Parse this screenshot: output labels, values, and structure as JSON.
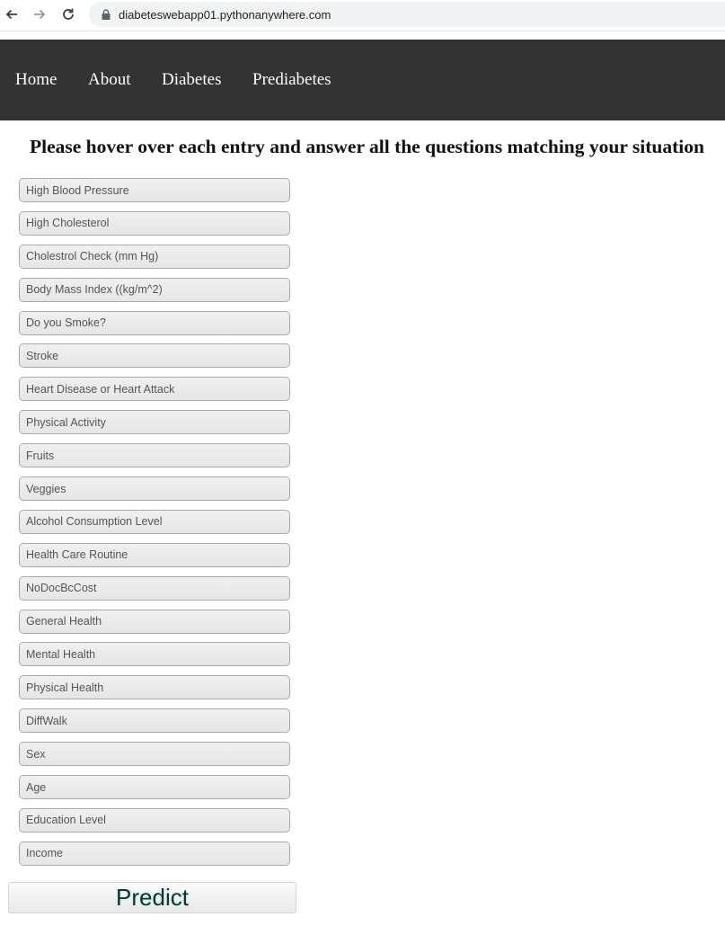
{
  "browser": {
    "url": "diabeteswebapp01.pythonanywhere.com",
    "icons": {
      "back": "arrow-left-icon",
      "forward": "arrow-right-icon",
      "reload": "reload-icon",
      "secure": "lock-icon"
    }
  },
  "nav": {
    "items": [
      {
        "label": "Home"
      },
      {
        "label": "About"
      },
      {
        "label": "Diabetes"
      },
      {
        "label": "Prediabetes"
      }
    ],
    "background": "#333333",
    "text_color": "#ffffff"
  },
  "heading": "Please hover over each entry and answer all the questions matching your situation",
  "form": {
    "fields": [
      {
        "placeholder": "High Blood Pressure"
      },
      {
        "placeholder": "High Cholesterol"
      },
      {
        "placeholder": "Cholestrol Check (mm Hg)"
      },
      {
        "placeholder": "Body Mass Index ((kg/m^2)"
      },
      {
        "placeholder": "Do you Smoke?"
      },
      {
        "placeholder": "Stroke"
      },
      {
        "placeholder": "Heart Disease or Heart Attack"
      },
      {
        "placeholder": "Physical Activity"
      },
      {
        "placeholder": "Fruits"
      },
      {
        "placeholder": "Veggies"
      },
      {
        "placeholder": "Alcohol Consumption Level"
      },
      {
        "placeholder": "Health Care Routine"
      },
      {
        "placeholder": "NoDocBcCost"
      },
      {
        "placeholder": "General Health"
      },
      {
        "placeholder": "Mental Health"
      },
      {
        "placeholder": "Physical Health"
      },
      {
        "placeholder": "DiffWalk"
      },
      {
        "placeholder": "Sex"
      },
      {
        "placeholder": "Age"
      },
      {
        "placeholder": "Education Level"
      },
      {
        "placeholder": "Income"
      }
    ],
    "submit_label": "Predict"
  }
}
